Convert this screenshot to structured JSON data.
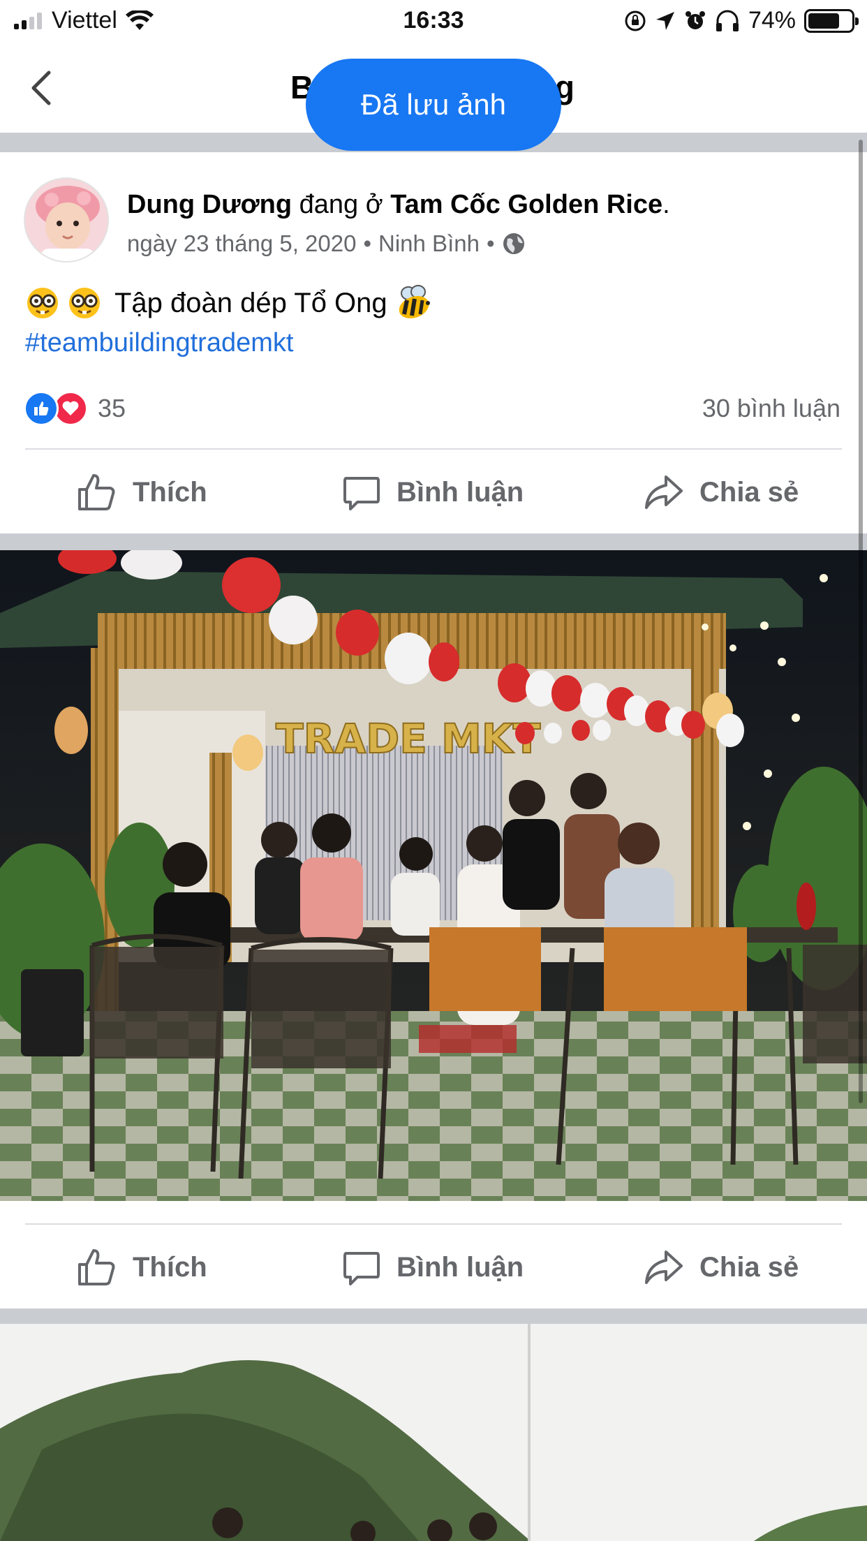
{
  "status_bar": {
    "carrier": "Viettel",
    "time": "16:33",
    "battery_percent": "74%",
    "battery_level": 0.74,
    "signal_bars": 4,
    "signal_active": 2
  },
  "nav": {
    "title_left": "B",
    "title_right": "g",
    "toast": "Đã lưu ảnh"
  },
  "post": {
    "author": "Dung Dương",
    "checkin_verb": "đang ở",
    "place": "Tam Cốc Golden Rice",
    "date": "ngày 23 tháng 5, 2020",
    "location": "Ninh Bình",
    "separator": "•",
    "privacy_icon": "globe-icon",
    "text": "Tập đoàn dép Tổ Ong",
    "hashtag": "#teambuildingtrademkt",
    "reaction_count": "35",
    "comment_count": "30 bình luận"
  },
  "actions": {
    "like": "Thích",
    "comment": "Bình luận",
    "share": "Chia sẻ"
  },
  "photo": {
    "banner_text": "TRADE MKT"
  },
  "colors": {
    "accent": "#1877f2",
    "love": "#f02849",
    "link": "#216fdb",
    "muted": "#65676b",
    "separator": "#c9ccd1"
  }
}
